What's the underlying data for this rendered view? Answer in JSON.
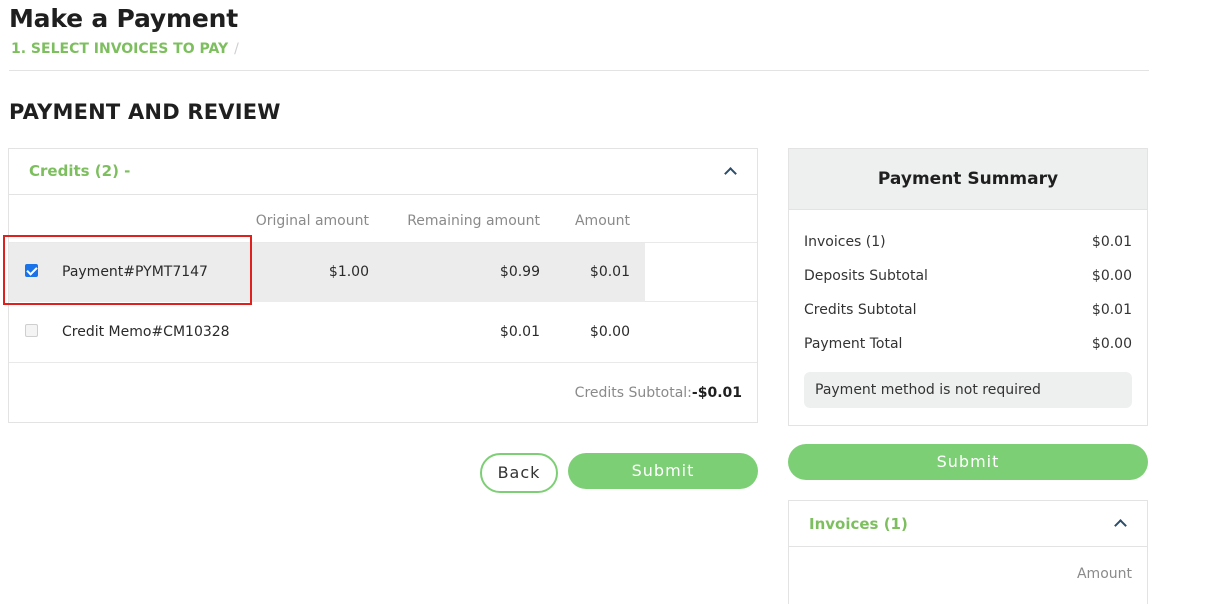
{
  "page": {
    "title": "Make a Payment",
    "breadcrumb": {
      "step": "1. SELECT INVOICES TO PAY",
      "separator": "/"
    },
    "section_title": "PAYMENT AND REVIEW"
  },
  "credits": {
    "title": "Credits (2) -",
    "columns": {
      "original": "Original amount",
      "remaining": "Remaining amount",
      "amount": "Amount"
    },
    "rows": [
      {
        "name": "Payment#PYMT7147",
        "original": "$1.00",
        "remaining": "$0.99",
        "amount": "$0.01",
        "checked": true
      },
      {
        "name": "Credit Memo#CM10328",
        "original": "",
        "remaining": "$0.01",
        "amount": "$0.00",
        "checked": false
      }
    ],
    "subtotal_label": "Credits Subtotal:",
    "subtotal_value": "-$0.01"
  },
  "actions": {
    "back_label": "Back",
    "submit_label": "Submit"
  },
  "summary": {
    "title": "Payment Summary",
    "rows": [
      {
        "label": "Invoices (1)",
        "value": "$0.01"
      },
      {
        "label": "Deposits Subtotal",
        "value": "$0.00"
      },
      {
        "label": "Credits Subtotal",
        "value": "$0.01"
      },
      {
        "label": "Payment Total",
        "value": "$0.00"
      }
    ],
    "note": "Payment method is not required",
    "submit_label": "Submit"
  },
  "invoices": {
    "title": "Invoices (1)",
    "column_amount": "Amount"
  },
  "colors": {
    "accent_green": "#7dbf5e",
    "button_green": "#7dcf75",
    "highlight_red": "#e0201c",
    "checkbox_blue": "#1a73e8"
  },
  "icons": {
    "collapse": "chevron-up-icon"
  }
}
